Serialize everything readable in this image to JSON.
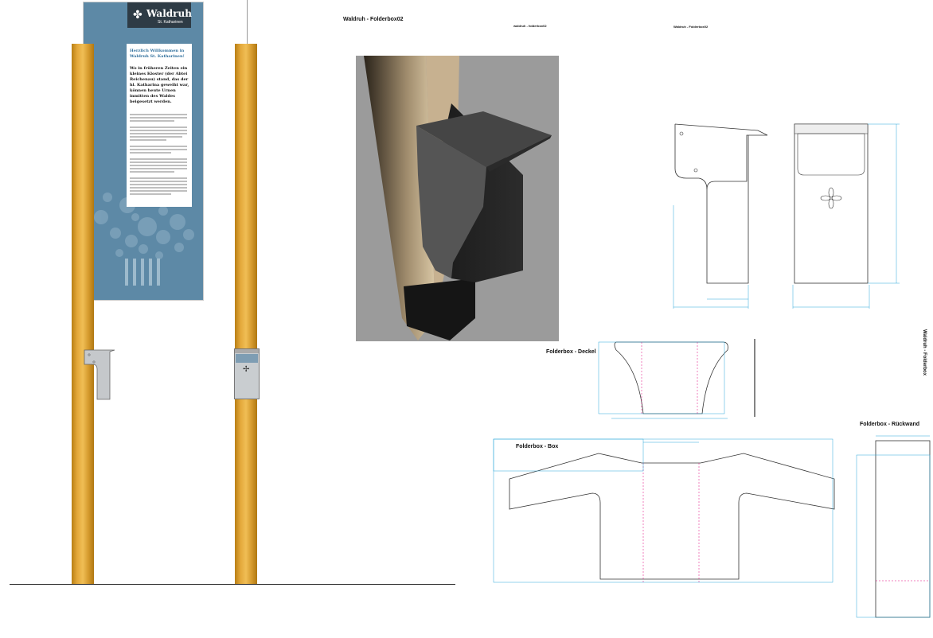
{
  "sign": {
    "brand": "Waldruh",
    "brand_sub": "St. Katharinen",
    "welcome": "Herzlich Willkommen in Waldruh St. Katharinen!",
    "lead": "Wo in früheren Zeiten ein kleines Kloster (der Abtei Reichenau) stand, das der hl. Katharina geweiht war, können heute Urnen inmitten des Waldes beigesetzt werden."
  },
  "titles": {
    "render_title": "Waldruh - Folderbox02",
    "tiny_center": "waldruh - folderbox02",
    "tech_title": "Waldruh - Folderbox02",
    "deckel": "Folderbox - Deckel",
    "box": "Folderbox - Box",
    "rueckwand": "Folderbox - Rückwand",
    "vertical": "Waldruh - Folderbox"
  },
  "colors": {
    "wood": "#e3a83a",
    "sign_blue": "#5d89a6",
    "dimension": "#2aa7d9",
    "cut_line": "#e0007a"
  }
}
